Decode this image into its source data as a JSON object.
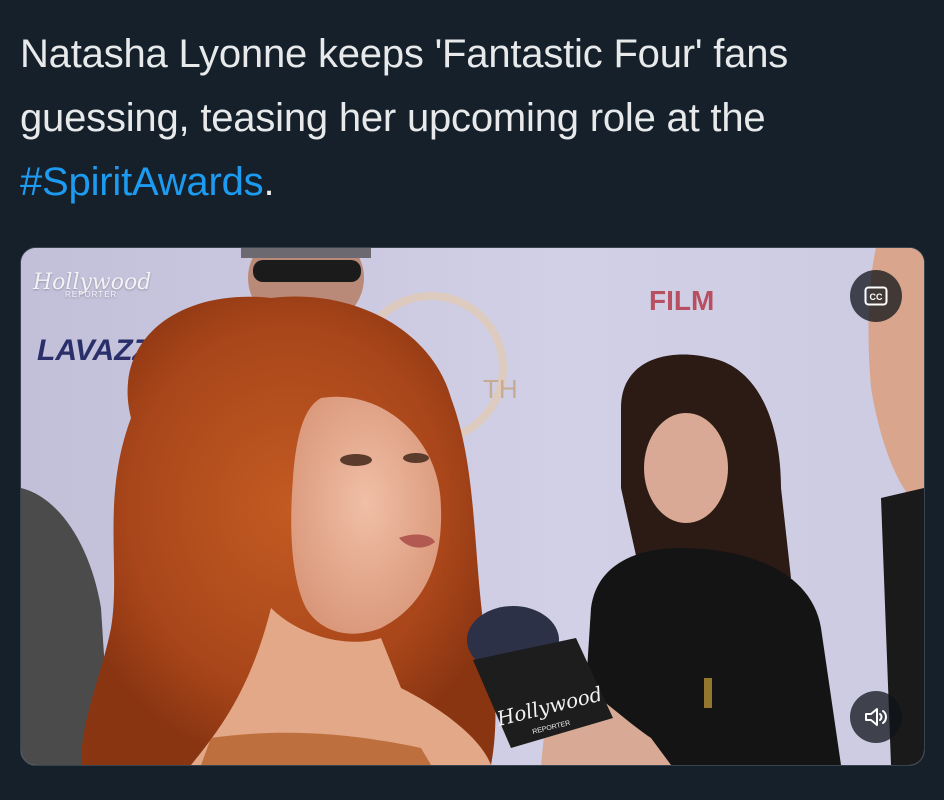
{
  "tweet": {
    "text_before": "Natasha Lyonne keeps 'Fantastic Four' fans guessing, teasing her upcoming role at the ",
    "hashtag": "#SpiritAwards",
    "text_after": "."
  },
  "media": {
    "watermark": "Hollywood",
    "watermark_sub": "REPORTER",
    "backdrop_brand": "LAVAZZA",
    "backdrop_film": "FILM",
    "backdrop_th": "TH",
    "mic_brand": "Hollywood",
    "mic_sub": "REPORTER",
    "controls": {
      "cc_label": "CC",
      "cc_icon": "closed-captions-icon",
      "mute_icon": "speaker-icon"
    }
  },
  "colors": {
    "background": "#15202b",
    "text": "#e7e9ea",
    "hashtag": "#1d9bf0"
  }
}
